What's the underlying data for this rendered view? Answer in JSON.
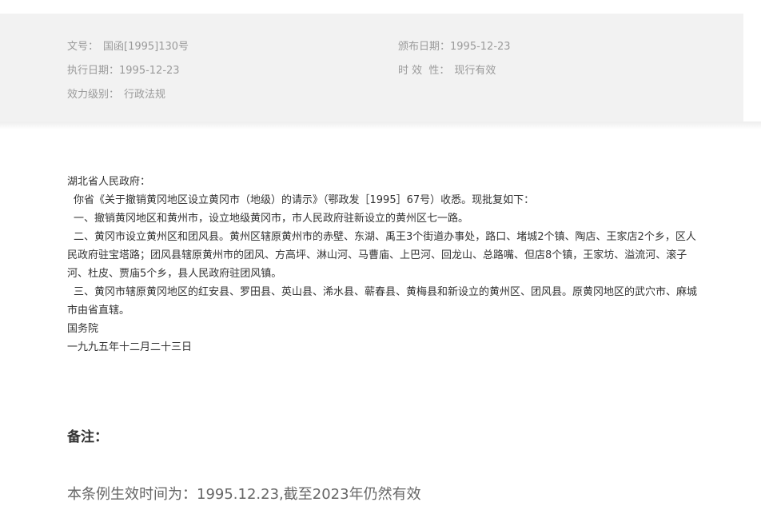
{
  "meta": {
    "doc_no_label": "文号：",
    "doc_no_value": "国函[1995]130号",
    "publish_date_label": "颁布日期：",
    "publish_date_value": "1995-12-23",
    "effective_date_label": "执行日期：",
    "effective_date_value": "1995-12-23",
    "validity_label": "时 效  性：",
    "validity_value": "现行有效",
    "level_label": "效力级别：",
    "level_value": "行政法规"
  },
  "body": {
    "addressee": "湖北省人民政府：",
    "para1": "你省《关于撤销黄冈地区设立黄冈市（地级）的请示》（鄂政发［1995］67号）收悉。现批复如下：",
    "para2": "一、撤销黄冈地区和黄州市，设立地级黄冈市，市人民政府驻新设立的黄州区七一路。",
    "para3": "二、黄冈市设立黄州区和团风县。黄州区辖原黄州市的赤壁、东湖、禹王3个街道办事处，路口、堵城2个镇、陶店、王家店2个乡，区人民政府驻宝塔路；团风县辖原黄州市的团风、方高坪、淋山河、马曹庙、上巴河、回龙山、总路嘴、但店8个镇，王家坊、溢流河、滚子河、杜皮、贾庙5个乡，县人民政府驻团风镇。",
    "para4": "三、黄冈市辖原黄冈地区的红安县、罗田县、英山县、浠水县、蕲春县、黄梅县和新设立的黄州区、团风县。原黄冈地区的武穴市、麻城市由省直辖。",
    "signer": "国务院",
    "date": "一九九五年十二月二十三日"
  },
  "note": {
    "title": "备注：",
    "text": "本条例生效时间为：1995.12.23,截至2023年仍然有效"
  }
}
